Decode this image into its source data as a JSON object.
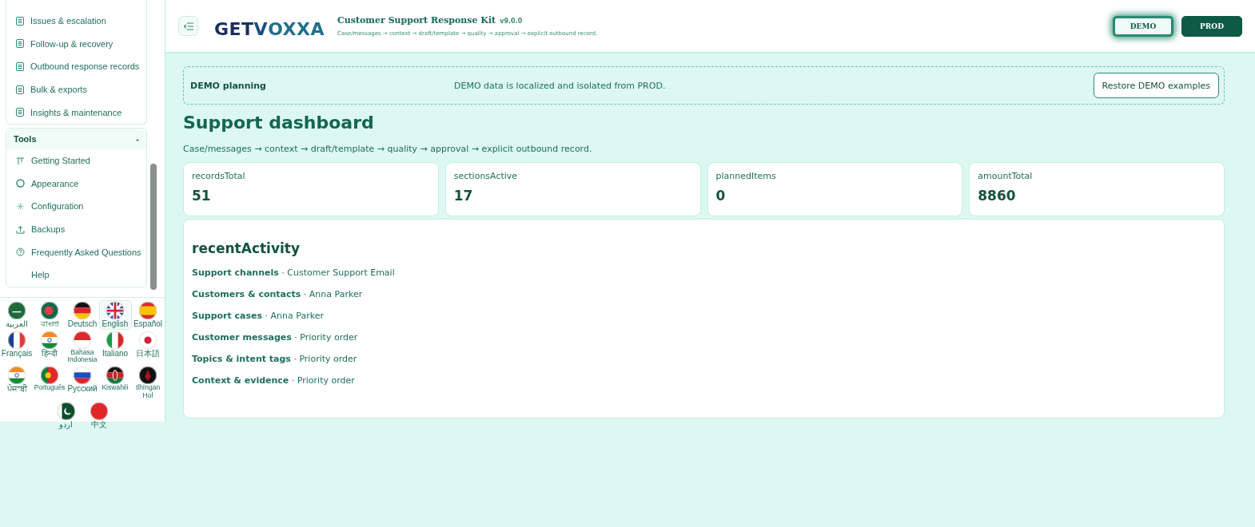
{
  "sidebar": {
    "nav_items": [
      {
        "label": "Issues & escalation"
      },
      {
        "label": "Follow-up & recovery"
      },
      {
        "label": "Outbound response records"
      },
      {
        "label": "Bulk & exports"
      },
      {
        "label": "Insights & maintenance"
      }
    ],
    "tools": {
      "title": "Tools",
      "toggle": "-",
      "expanded": true,
      "items": [
        {
          "label": "Getting Started",
          "kind": "guide"
        },
        {
          "label": "Appearance",
          "kind": "palette"
        },
        {
          "label": "Configuration",
          "kind": "gear"
        },
        {
          "label": "Backups",
          "kind": "upload"
        },
        {
          "label": "Frequently Asked Questions",
          "kind": "help"
        },
        {
          "label": "Help",
          "kind": "none"
        }
      ]
    },
    "languages": [
      {
        "label": "العربية",
        "kind": "saudi",
        "selected": false
      },
      {
        "label": "বাংলা",
        "kind": "bangladesh",
        "selected": false
      },
      {
        "label": "Deutsch",
        "kind": "germany",
        "selected": false
      },
      {
        "label": "English",
        "kind": "uk",
        "selected": true
      },
      {
        "label": "Español",
        "kind": "spain",
        "selected": false
      },
      {
        "label": "Français",
        "kind": "france",
        "selected": false
      },
      {
        "label": "हिन्दी",
        "kind": "india",
        "selected": false
      },
      {
        "label": "Bahasa Indonesia",
        "kind": "indonesia",
        "selected": false
      },
      {
        "label": "Italiano",
        "kind": "italy",
        "selected": false
      },
      {
        "label": "日本語",
        "kind": "japan",
        "selected": false
      },
      {
        "label": "ਪੰਜਾਬੀ",
        "kind": "india",
        "selected": false
      },
      {
        "label": "Português",
        "kind": "portugal",
        "selected": false
      },
      {
        "label": "Русский",
        "kind": "russia",
        "selected": false
      },
      {
        "label": "Kiswahili",
        "kind": "kenya",
        "selected": false
      },
      {
        "label": "tlhIngan Hol",
        "kind": "klingon",
        "selected": false
      },
      {
        "label": "اردو",
        "kind": "pakistan",
        "selected": false
      },
      {
        "label": "中文",
        "kind": "china",
        "selected": false
      }
    ]
  },
  "header": {
    "logo": {
      "prefix": "GET",
      "middle": "V",
      "suffix": "OXXA"
    },
    "title": "Customer Support Response Kit",
    "version": "v9.0.0",
    "subtitle": "Case/messages → context → draft/template → quality → approval → explicit outbound record.",
    "modes": [
      {
        "label": "DEMO",
        "selected": true
      },
      {
        "label": "PROD",
        "selected": false
      }
    ]
  },
  "banner": {
    "title": "DEMO planning",
    "message": "DEMO data is localized and isolated from PROD.",
    "button": "Restore DEMO examples"
  },
  "page": {
    "title": "Support dashboard",
    "subtitle": "Case/messages → context → draft/template → quality → approval → explicit outbound record."
  },
  "stats": [
    {
      "label": "recordsTotal",
      "value": "51"
    },
    {
      "label": "sectionsActive",
      "value": "17"
    },
    {
      "label": "plannedItems",
      "value": "0"
    },
    {
      "label": "amountTotal",
      "value": "8860"
    }
  ],
  "activity": {
    "title": "recentActivity",
    "items": [
      {
        "section": "Support channels",
        "detail": "· Customer Support Email"
      },
      {
        "section": "Customers & contacts",
        "detail": "· Anna Parker"
      },
      {
        "section": "Support cases",
        "detail": "· Anna Parker"
      },
      {
        "section": "Customer messages",
        "detail": "· Priority order"
      },
      {
        "section": "Topics & intent tags",
        "detail": "· Priority order"
      },
      {
        "section": "Context & evidence",
        "detail": "· Priority order"
      }
    ]
  }
}
